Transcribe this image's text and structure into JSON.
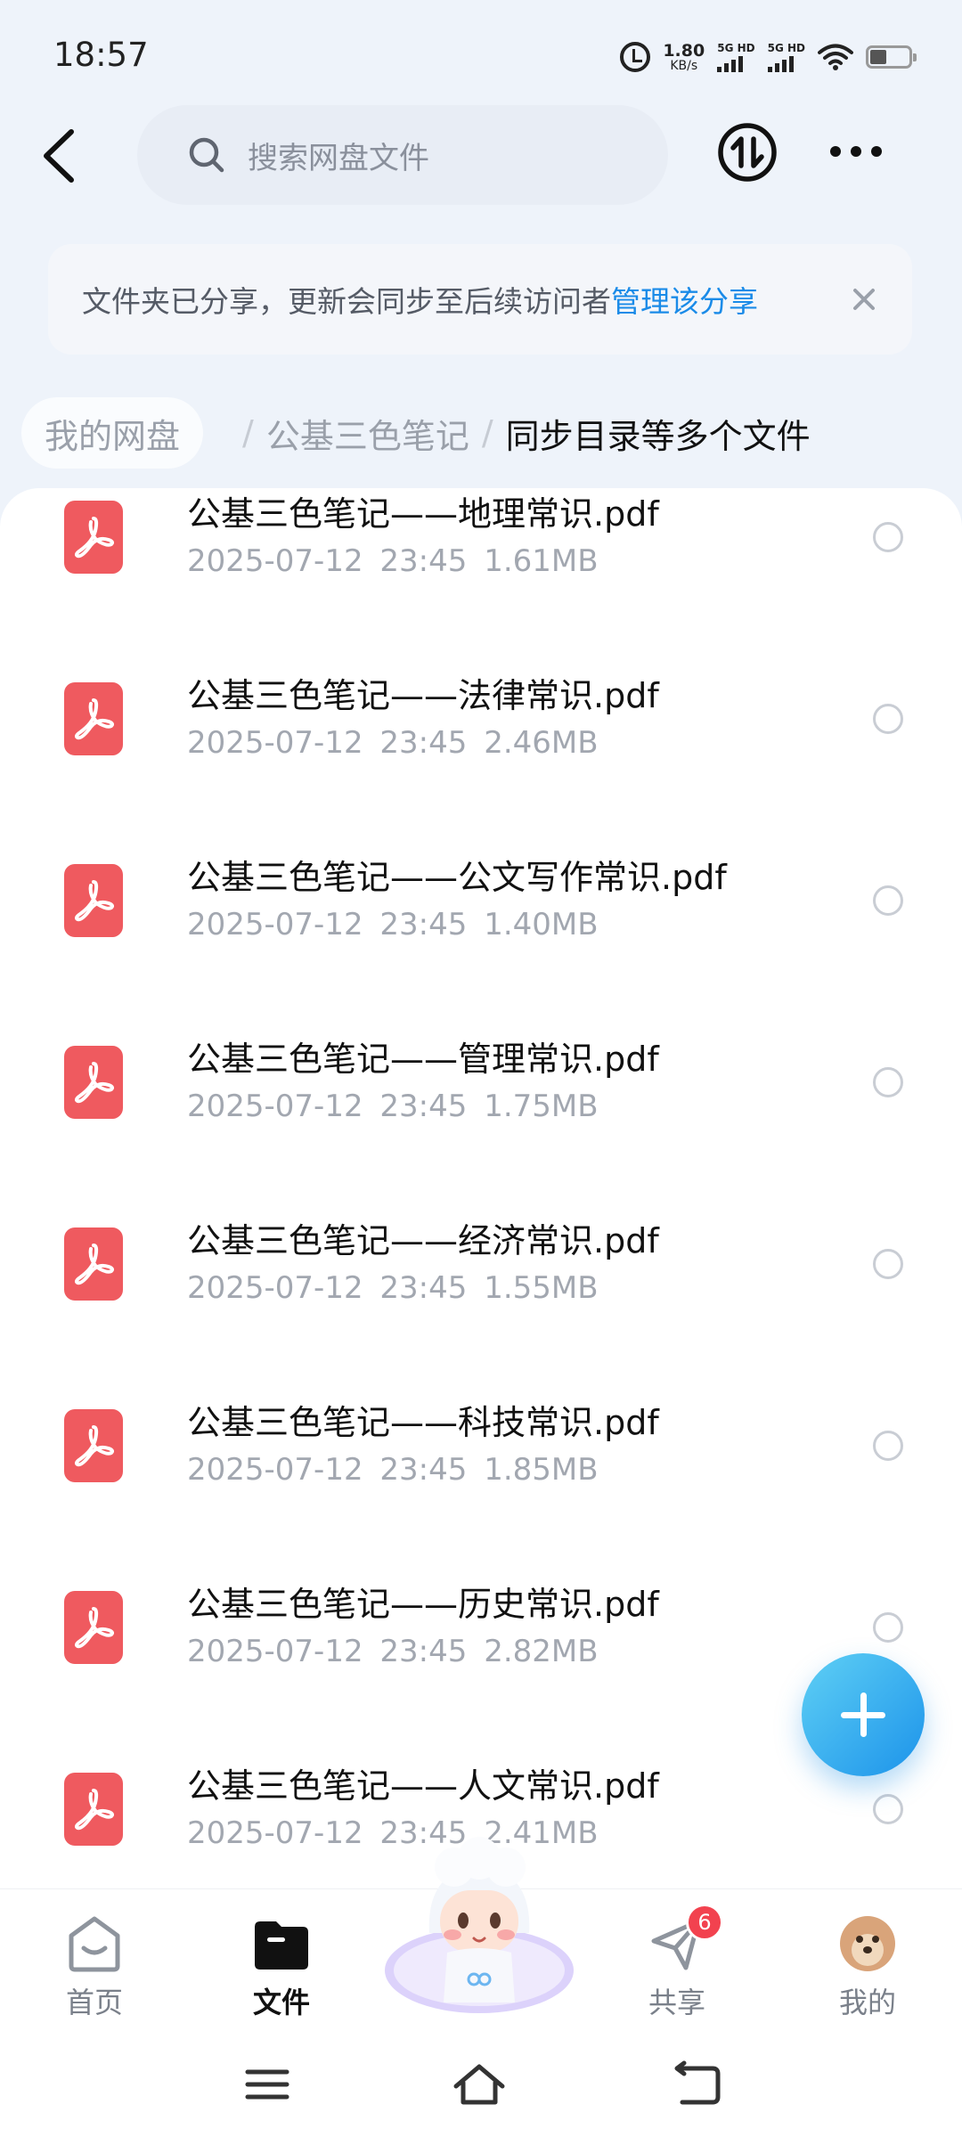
{
  "status_bar": {
    "time": "18:57",
    "net_speed_value": "1.80",
    "net_speed_unit": "KB/s",
    "sim1": "5G HD",
    "sim2": "5G HD",
    "icons": [
      "alarm-icon",
      "wifi-icon",
      "battery-icon"
    ]
  },
  "header": {
    "search_placeholder": "搜索网盘文件",
    "icons": [
      "back-icon",
      "search-icon",
      "transfer-icon",
      "more-icon"
    ]
  },
  "notice": {
    "text": "文件夹已分享，更新会同步至后续访问者",
    "link": "管理该分享"
  },
  "breadcrumb": {
    "home": "我的网盘",
    "separator": "/",
    "folder": "公基三色笔记",
    "current": "同步目录等多个文件"
  },
  "files": [
    {
      "name": "公基三色笔记——地理常识.pdf",
      "date": "2025-07-12",
      "time": "23:45",
      "size": "1.61MB"
    },
    {
      "name": "公基三色笔记——法律常识.pdf",
      "date": "2025-07-12",
      "time": "23:45",
      "size": "2.46MB"
    },
    {
      "name": "公基三色笔记——公文写作常识.pdf",
      "date": "2025-07-12",
      "time": "23:45",
      "size": "1.40MB"
    },
    {
      "name": "公基三色笔记——管理常识.pdf",
      "date": "2025-07-12",
      "time": "23:45",
      "size": "1.75MB"
    },
    {
      "name": "公基三色笔记——经济常识.pdf",
      "date": "2025-07-12",
      "time": "23:45",
      "size": "1.55MB"
    },
    {
      "name": "公基三色笔记——科技常识.pdf",
      "date": "2025-07-12",
      "time": "23:45",
      "size": "1.85MB"
    },
    {
      "name": "公基三色笔记——历史常识.pdf",
      "date": "2025-07-12",
      "time": "23:45",
      "size": "2.82MB"
    },
    {
      "name": "公基三色笔记——人文常识.pdf",
      "date": "2025-07-12",
      "time": "23:45",
      "size": "2.41MB"
    }
  ],
  "bottom_nav": {
    "items": [
      {
        "label": "首页",
        "icon": "home-icon"
      },
      {
        "label": "文件",
        "icon": "folder-icon"
      },
      {
        "label": "共享",
        "icon": "share-icon",
        "badge": "6"
      },
      {
        "label": "我的",
        "icon": "profile-avatar-icon"
      }
    ],
    "active": "文件"
  },
  "colors": {
    "accent": "#1a8be8",
    "pdf_red": "#ef5a5f",
    "badge_red": "#f2424f"
  }
}
